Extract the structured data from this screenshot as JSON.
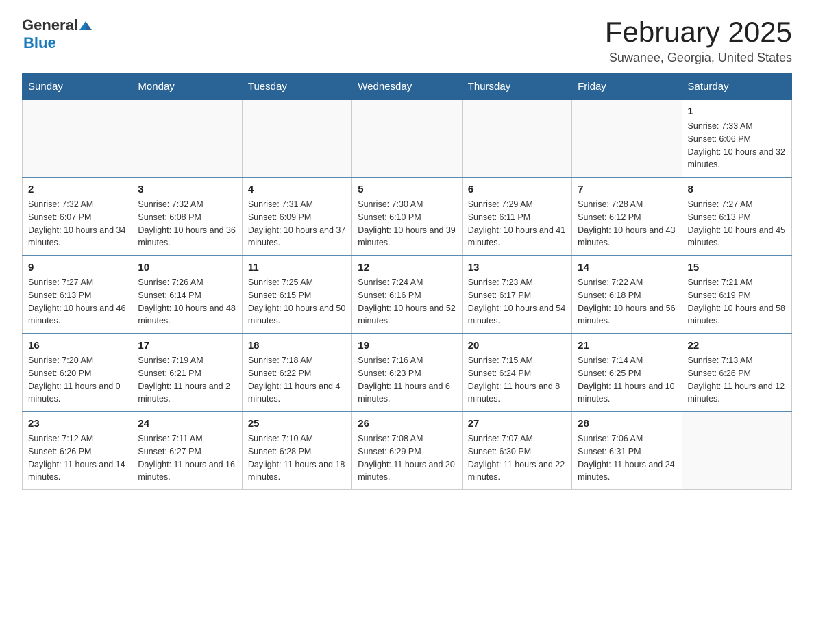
{
  "header": {
    "logo_general": "General",
    "logo_blue": "Blue",
    "title": "February 2025",
    "location": "Suwanee, Georgia, United States"
  },
  "days_of_week": [
    "Sunday",
    "Monday",
    "Tuesday",
    "Wednesday",
    "Thursday",
    "Friday",
    "Saturday"
  ],
  "weeks": [
    [
      {
        "day": "",
        "info": ""
      },
      {
        "day": "",
        "info": ""
      },
      {
        "day": "",
        "info": ""
      },
      {
        "day": "",
        "info": ""
      },
      {
        "day": "",
        "info": ""
      },
      {
        "day": "",
        "info": ""
      },
      {
        "day": "1",
        "info": "Sunrise: 7:33 AM\nSunset: 6:06 PM\nDaylight: 10 hours and 32 minutes."
      }
    ],
    [
      {
        "day": "2",
        "info": "Sunrise: 7:32 AM\nSunset: 6:07 PM\nDaylight: 10 hours and 34 minutes."
      },
      {
        "day": "3",
        "info": "Sunrise: 7:32 AM\nSunset: 6:08 PM\nDaylight: 10 hours and 36 minutes."
      },
      {
        "day": "4",
        "info": "Sunrise: 7:31 AM\nSunset: 6:09 PM\nDaylight: 10 hours and 37 minutes."
      },
      {
        "day": "5",
        "info": "Sunrise: 7:30 AM\nSunset: 6:10 PM\nDaylight: 10 hours and 39 minutes."
      },
      {
        "day": "6",
        "info": "Sunrise: 7:29 AM\nSunset: 6:11 PM\nDaylight: 10 hours and 41 minutes."
      },
      {
        "day": "7",
        "info": "Sunrise: 7:28 AM\nSunset: 6:12 PM\nDaylight: 10 hours and 43 minutes."
      },
      {
        "day": "8",
        "info": "Sunrise: 7:27 AM\nSunset: 6:13 PM\nDaylight: 10 hours and 45 minutes."
      }
    ],
    [
      {
        "day": "9",
        "info": "Sunrise: 7:27 AM\nSunset: 6:13 PM\nDaylight: 10 hours and 46 minutes."
      },
      {
        "day": "10",
        "info": "Sunrise: 7:26 AM\nSunset: 6:14 PM\nDaylight: 10 hours and 48 minutes."
      },
      {
        "day": "11",
        "info": "Sunrise: 7:25 AM\nSunset: 6:15 PM\nDaylight: 10 hours and 50 minutes."
      },
      {
        "day": "12",
        "info": "Sunrise: 7:24 AM\nSunset: 6:16 PM\nDaylight: 10 hours and 52 minutes."
      },
      {
        "day": "13",
        "info": "Sunrise: 7:23 AM\nSunset: 6:17 PM\nDaylight: 10 hours and 54 minutes."
      },
      {
        "day": "14",
        "info": "Sunrise: 7:22 AM\nSunset: 6:18 PM\nDaylight: 10 hours and 56 minutes."
      },
      {
        "day": "15",
        "info": "Sunrise: 7:21 AM\nSunset: 6:19 PM\nDaylight: 10 hours and 58 minutes."
      }
    ],
    [
      {
        "day": "16",
        "info": "Sunrise: 7:20 AM\nSunset: 6:20 PM\nDaylight: 11 hours and 0 minutes."
      },
      {
        "day": "17",
        "info": "Sunrise: 7:19 AM\nSunset: 6:21 PM\nDaylight: 11 hours and 2 minutes."
      },
      {
        "day": "18",
        "info": "Sunrise: 7:18 AM\nSunset: 6:22 PM\nDaylight: 11 hours and 4 minutes."
      },
      {
        "day": "19",
        "info": "Sunrise: 7:16 AM\nSunset: 6:23 PM\nDaylight: 11 hours and 6 minutes."
      },
      {
        "day": "20",
        "info": "Sunrise: 7:15 AM\nSunset: 6:24 PM\nDaylight: 11 hours and 8 minutes."
      },
      {
        "day": "21",
        "info": "Sunrise: 7:14 AM\nSunset: 6:25 PM\nDaylight: 11 hours and 10 minutes."
      },
      {
        "day": "22",
        "info": "Sunrise: 7:13 AM\nSunset: 6:26 PM\nDaylight: 11 hours and 12 minutes."
      }
    ],
    [
      {
        "day": "23",
        "info": "Sunrise: 7:12 AM\nSunset: 6:26 PM\nDaylight: 11 hours and 14 minutes."
      },
      {
        "day": "24",
        "info": "Sunrise: 7:11 AM\nSunset: 6:27 PM\nDaylight: 11 hours and 16 minutes."
      },
      {
        "day": "25",
        "info": "Sunrise: 7:10 AM\nSunset: 6:28 PM\nDaylight: 11 hours and 18 minutes."
      },
      {
        "day": "26",
        "info": "Sunrise: 7:08 AM\nSunset: 6:29 PM\nDaylight: 11 hours and 20 minutes."
      },
      {
        "day": "27",
        "info": "Sunrise: 7:07 AM\nSunset: 6:30 PM\nDaylight: 11 hours and 22 minutes."
      },
      {
        "day": "28",
        "info": "Sunrise: 7:06 AM\nSunset: 6:31 PM\nDaylight: 11 hours and 24 minutes."
      },
      {
        "day": "",
        "info": ""
      }
    ]
  ]
}
